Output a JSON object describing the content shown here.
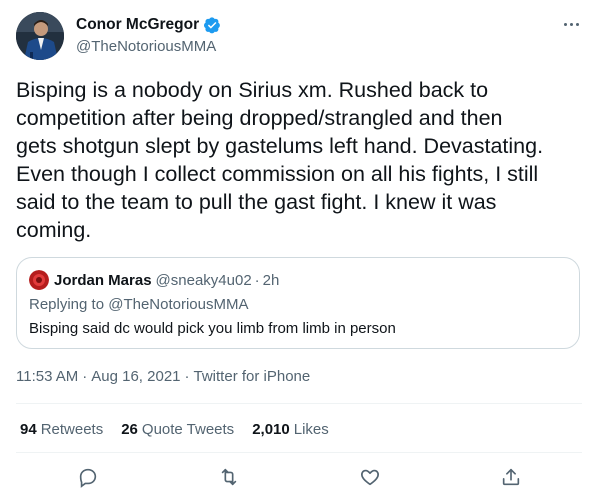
{
  "author": {
    "display_name": "Conor McGregor",
    "handle": "@TheNotoriousMMA",
    "verified": true
  },
  "tweet": {
    "text": "Bisping is a nobody on Sirius xm. Rushed back to\ncompetition after being dropped/strangled and then\ngets shotgun slept by gastelums left hand. Devastating.\nEven though I collect commission on all his fights, I still\nsaid to the team to pull the gast fight. I knew it was\ncoming."
  },
  "quote": {
    "display_name": "Jordan Maras",
    "handle": "@sneaky4u02",
    "separator": "·",
    "time": "2h",
    "replying_prefix": "Replying to",
    "replying_to": "@TheNotoriousMMA",
    "text": "Bisping said dc would pick you limb from limb in person"
  },
  "meta": {
    "time": "11:53 AM",
    "separator": "·",
    "date": "Aug 16, 2021",
    "source": "Twitter for iPhone"
  },
  "stats": {
    "retweets_count": "94",
    "retweets_label": "Retweets",
    "quotes_count": "26",
    "quotes_label": "Quote Tweets",
    "likes_count": "2,010",
    "likes_label": "Likes"
  },
  "colors": {
    "text_primary": "#0f1419",
    "text_secondary": "#536471",
    "verified_blue": "#1d9bf0",
    "border": "#cfd9de"
  },
  "icons": [
    "more-icon",
    "verified-icon",
    "reply-icon",
    "retweet-icon",
    "like-icon",
    "share-icon"
  ]
}
